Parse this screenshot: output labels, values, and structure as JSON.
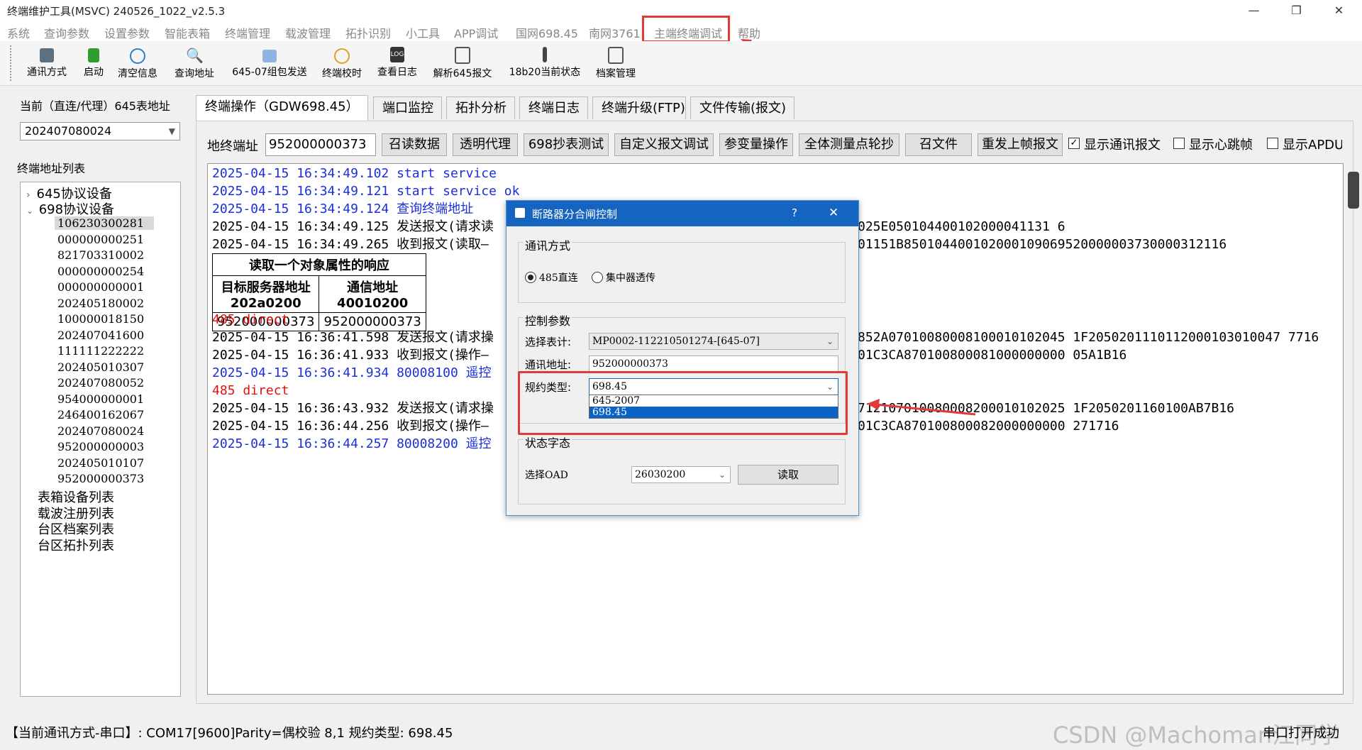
{
  "window": {
    "title": "终端维护工具(MSVC) 240526_1022_v2.5.3",
    "min": "—",
    "max": "❐",
    "close": "✕"
  },
  "menu": [
    "系统",
    "查询参数",
    "设置参数",
    "智能表箱",
    "终端管理",
    "载波管理",
    "拓扑识别",
    "小工具",
    "APP调试",
    "国网698.45",
    "南网3761",
    "主端终端调试",
    "帮助"
  ],
  "toolbar": [
    {
      "label": "通讯方式",
      "icon": "comm-icon",
      "color": "#5c7080"
    },
    {
      "label": "启动",
      "icon": "start-icon",
      "color": "#2e9e2e"
    },
    {
      "label": "清空信息",
      "icon": "clear-icon",
      "color": "#2a7fc9"
    },
    {
      "label": "查询地址",
      "icon": "search-icon",
      "color": "#2a7fc9"
    },
    {
      "label": "645-07组包发送",
      "icon": "package-icon",
      "color": "#5c9bd6"
    },
    {
      "label": "终端校时",
      "icon": "clock-icon",
      "color": "#e0a020"
    },
    {
      "label": "查看日志",
      "icon": "log-icon",
      "color": "#333333"
    },
    {
      "label": "解析645报文",
      "icon": "edit-icon",
      "color": "#555555"
    },
    {
      "label": "18b20当前状态",
      "icon": "thermometer-icon",
      "color": "#444444"
    },
    {
      "label": "档案管理",
      "icon": "archive-icon",
      "color": "#555555"
    }
  ],
  "left": {
    "addr_label": "当前（直连/代理）645表地址",
    "addr_value": "202407080024",
    "list_label": "终端地址列表",
    "tree": {
      "node645": "645协议设备",
      "node698": "698协议设备",
      "addrs": [
        "106230300281",
        "000000000251",
        "821703310002",
        "000000000254",
        "000000000001",
        "202405180002",
        "100000018150",
        "202407041600",
        "111111222222",
        "202405010307",
        "202407080052",
        "954000000001",
        "246400162067",
        "202407080024",
        "952000000003",
        "202405010107",
        "952000000373"
      ],
      "others": [
        "表箱设备列表",
        "载波注册列表",
        "台区档案列表",
        "台区拓扑列表"
      ]
    }
  },
  "tabs": [
    "终端操作（GDW698.45）",
    "端口监控",
    "拓扑分析",
    "终端日志",
    "终端升级(FTP)",
    "文件传输(报文)"
  ],
  "controls": {
    "addr_label": "地终端址",
    "addr_value": "952000000373",
    "buttons": [
      "召读数据",
      "透明代理",
      "698抄表测试",
      "自定义报文调试",
      "参变量操作",
      "全体测量点轮抄",
      "召文件",
      "重发上帧报文"
    ],
    "checkboxes": [
      {
        "label": "显示通讯报文",
        "checked": true
      },
      {
        "label": "显示心跳帧",
        "checked": false
      },
      {
        "label": "显示APDU",
        "checked": false
      }
    ]
  },
  "log": [
    {
      "text": "2025-04-15 16:34:49.102 start service",
      "color": "blue"
    },
    {
      "text": "2025-04-15 16:34:49.121 start service ok",
      "color": "blue"
    },
    {
      "text": "2025-04-15 16:34:49.124 查询终端地址",
      "color": "blue"
    },
    {
      "text": "2025-04-15 16:34:49.125 发送报文(请求读",
      "color": "black",
      "tail": "025E050104400102000041131 6"
    },
    {
      "text": "2025-04-15 16:34:49.265 收到报文(读取—",
      "color": "black",
      "tail": "01151B850104400102000109069520000003730000312116"
    }
  ],
  "resp_table": {
    "title": "读取一个对象属性的响应",
    "h1": "目标服务器地址\n202a0200",
    "h2": "通信地址\n40010200",
    "v1": "952000000373",
    "v2": "952000000373"
  },
  "log2": [
    {
      "text": "485 direct",
      "color": "red"
    },
    {
      "text": "2025-04-15 16:36:41.598 发送报文(请求操",
      "color": "black",
      "tail": "852A07010080008100010102045 1F2050201110112000103010047 7716"
    },
    {
      "text": "2025-04-15 16:36:41.933 收到报文(操作—",
      "color": "black",
      "tail": "01C3CA870100800081000000000 05A1B16"
    },
    {
      "text": "2025-04-15 16:36:41.934 80008100 遥控",
      "color": "blue"
    },
    {
      "text": "485 direct",
      "color": "red"
    },
    {
      "text": "2025-04-15 16:36:43.932 发送报文(请求操",
      "color": "black",
      "tail": "712107010080008200010102025 1F2050201160100AB7B16"
    },
    {
      "text": "2025-04-15 16:36:44.256 收到报文(操作—",
      "color": "black",
      "tail": "01C3CA870100800082000000000 271716"
    },
    {
      "text": "2025-04-15 16:36:44.257 80008200 遥控",
      "color": "blue"
    }
  ],
  "dialog": {
    "title": "断路器分合闸控制",
    "help": "?",
    "close": "✕",
    "comm_group": "通讯方式",
    "radio1": "485直连",
    "radio2": "集中器透传",
    "ctrl_group": "控制参数",
    "meter_label": "选择表计:",
    "meter_value": "MP0002-112210501274-[645-07]",
    "addr_label": "通讯地址:",
    "addr_value": "952000000373",
    "proto_label": "规约类型:",
    "proto_value": "698.45",
    "proto_options": [
      "645-2007",
      "698.45"
    ],
    "status_group": "状态字态",
    "oad_label": "选择OAD",
    "oad_value": "26030200",
    "read_btn": "读取"
  },
  "status": {
    "text": "【当前通讯方式-串口】: COM17[9600]Parity=偶校验 8,1 规约类型: 698.45",
    "right": "串口打开成功",
    "watermark": "CSDN @Machoman江同学"
  }
}
